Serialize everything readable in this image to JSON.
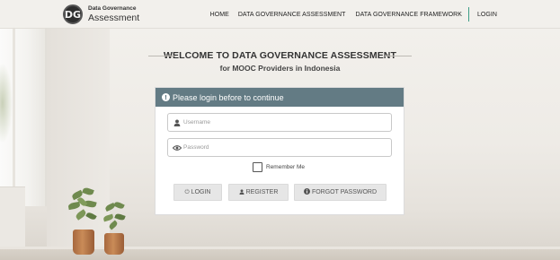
{
  "header": {
    "logo_line1": "Data Governance",
    "logo_line2": "Assessment",
    "logo_mark": "DG",
    "nav": [
      {
        "label": "HOME"
      },
      {
        "label": "DATA GOVERNANCE ASSESSMENT"
      },
      {
        "label": "DATA GOVERNANCE FRAMEWORK"
      },
      {
        "label": "LOGIN"
      }
    ]
  },
  "welcome": {
    "title": "WELCOME TO DATA GOVERNANCE ASSESSMENT",
    "subtitle": "for MOOC Providers in Indonesia"
  },
  "login": {
    "notice": "Please login before to continue",
    "notice_icon": "info-icon",
    "username_placeholder": "Username",
    "username_value": "",
    "password_placeholder": "Password",
    "password_value": "",
    "remember_label": "Remember Me",
    "remember_checked": false,
    "buttons": {
      "login": "LOGIN",
      "register": "REGISTER",
      "forgot": "FORGOT PASSWORD"
    }
  },
  "colors": {
    "panel_header": "#637b84",
    "nav_separator": "#3d9e86",
    "button_bg": "#e6e6e6"
  }
}
